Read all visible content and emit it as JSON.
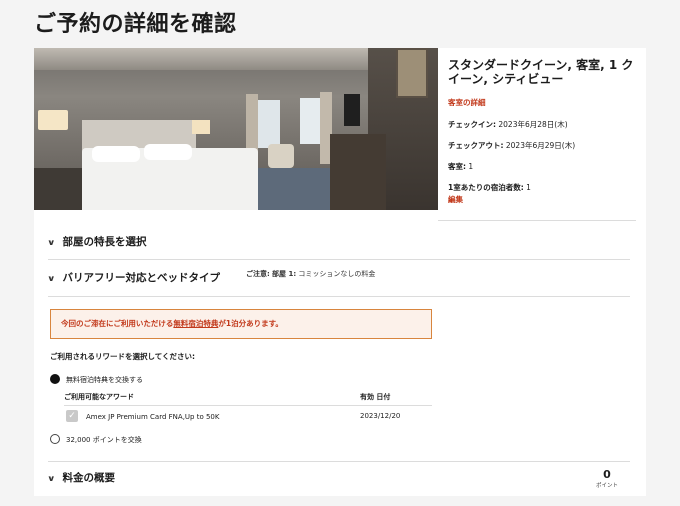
{
  "page": {
    "title": "ご予約の詳細を確認"
  },
  "room": {
    "name": "スタンダードクイーン, 客室, 1 クイーン, シティビュー",
    "details_link": "客室の詳細",
    "checkin_label": "チェックイン:",
    "checkin_value": "2023年6月28日(木)",
    "checkout_label": "チェックアウト:",
    "checkout_value": "2023年6月29日(木)",
    "rooms_label": "客室:",
    "rooms_value": "1",
    "guests_label": "1室あたりの宿泊者数:",
    "guests_value": "1",
    "edit_link": "編集"
  },
  "sections": {
    "features": "部屋の特長を選択",
    "accessibility": "バリアフリー対応とベッドタイプ",
    "summary": "料金の概要"
  },
  "note": {
    "label": "ご注意:",
    "room_label": "部屋 1:",
    "text": "コミッションなしの料金"
  },
  "notice": {
    "pre": "今回のご滞在にご利用いただける",
    "link": "無料宿泊特典",
    "post": "が1泊分あります。"
  },
  "rewards": {
    "prompt": "ご利用されるリワードを選択してください:",
    "option_free_night": "無料宿泊特典を交換する",
    "col_award": "ご利用可能なアワード",
    "col_expiry": "有効 日付",
    "award_name": "Amex JP Premium Card FNA,Up to 50K",
    "award_expiry": "2023/12/20",
    "option_points": "32,000 ポイントを交換"
  },
  "summary": {
    "points_value": "0",
    "points_unit": "ポイント"
  },
  "icons": {
    "chevron": "chevron-down-icon",
    "check": "check-icon"
  },
  "colors": {
    "accent": "#c2391b",
    "notice_border": "#d8853e",
    "notice_bg": "#fcf1ea"
  }
}
